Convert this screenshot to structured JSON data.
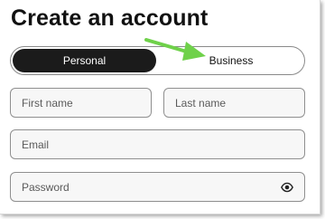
{
  "form": {
    "title": "Create an account",
    "account_type": {
      "options": [
        "Personal",
        "Business"
      ],
      "selected": "Personal"
    },
    "fields": {
      "first_name": {
        "placeholder": "First name",
        "value": ""
      },
      "last_name": {
        "placeholder": "Last name",
        "value": ""
      },
      "email": {
        "placeholder": "Email",
        "value": ""
      },
      "password": {
        "placeholder": "Password",
        "value": ""
      }
    },
    "password_toggle_icon": "eye-icon"
  },
  "annotation": {
    "arrow_color": "#6fd14a",
    "arrow_target": "Business"
  },
  "colors": {
    "toggle_active_bg": "#1b1b1b",
    "toggle_active_text": "#ffffff",
    "field_bg": "#f7f7f7",
    "field_border": "#8f8f8f"
  }
}
